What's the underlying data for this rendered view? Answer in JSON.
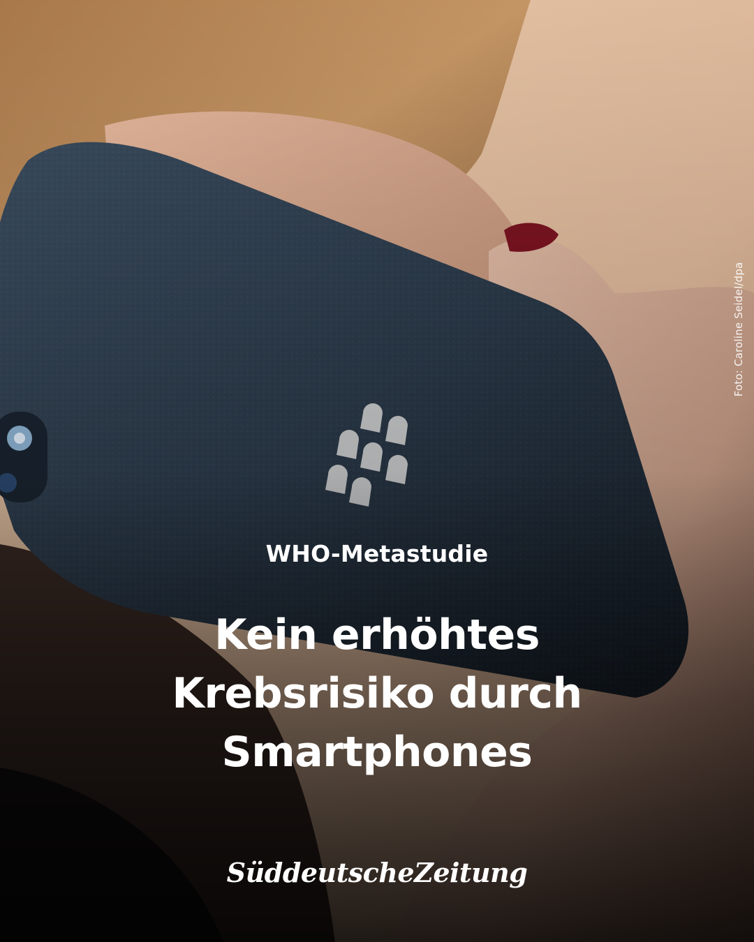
{
  "photo": {
    "description_icon": "phone-call-photo",
    "credit": "Foto: Caroline Seidel/dpa"
  },
  "article": {
    "kicker": "WHO-Metastudie",
    "headline_lines": [
      "Kein erhöhtes",
      "Krebsrisiko durch",
      "Smartphones"
    ]
  },
  "brand": {
    "name": "SüddeutscheZeitung",
    "icon": "sueddeutsche-zeitung-logo"
  },
  "colors": {
    "text": "#ffffff",
    "phone": "#2a3a4a",
    "background": "#e9c9a8"
  }
}
